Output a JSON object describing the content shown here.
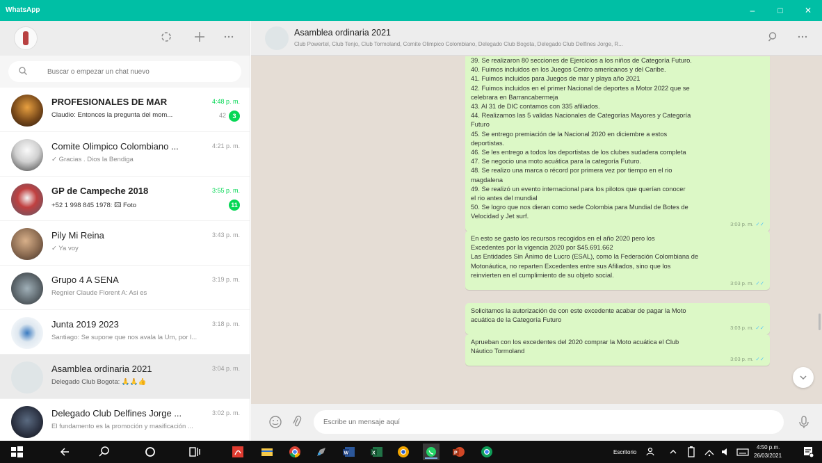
{
  "window": {
    "title": "WhatsApp",
    "buttons": {
      "minimize": "–",
      "maximize": "□",
      "close": "✕"
    }
  },
  "sidebar": {
    "icons": [
      "status-icon",
      "new-chat-icon",
      "menu-icon"
    ],
    "search": {
      "placeholder": "Buscar o empezar un chat nuevo",
      "value": ""
    },
    "chats": [
      {
        "name": "PROFESIONALES DE MAR",
        "time": "4:48 p. m.",
        "preview": "Claudio: Entonces la pregunta del mom...",
        "mention": "42",
        "unread": "3",
        "time_green": true
      },
      {
        "name": "Comite Olimpico Colombiano ...",
        "time": "4:21 p. m.",
        "preview": "✓ Gracias . Dios la Bendiga",
        "unread": "",
        "time_green": false
      },
      {
        "name": "GP de Campeche 2018",
        "time": "3:55 p. m.",
        "preview": "+52 1 998 845 1978: 🖾 Foto",
        "unread": "11",
        "time_green": true
      },
      {
        "name": "Pily Mi Reina",
        "time": "3:43 p. m.",
        "preview": "✓ Ya voy",
        "unread": "",
        "time_green": false
      },
      {
        "name": "Grupo 4 A SENA",
        "time": "3:19 p. m.",
        "preview": "Regnier Claude Florent A: Asi es",
        "unread": "",
        "time_green": false
      },
      {
        "name": "Junta 2019 2023",
        "time": "3:18 p. m.",
        "preview": "Santiago: Se supone que nos avala la Um, por l...",
        "unread": "",
        "time_green": false
      },
      {
        "name": "Asamblea ordinaria 2021",
        "time": "3:04 p. m.",
        "preview": "Delegado Club Bogota: 🙏🙏👍",
        "unread": "",
        "time_green": false,
        "active": true
      },
      {
        "name": "Delegado Club Delfines Jorge ...",
        "time": "3:02 p. m.",
        "preview": "El fundamento es la promoción y masificación ...",
        "unread": "",
        "time_green": false
      }
    ]
  },
  "conversation": {
    "title": "Asamblea ordinaria 2021",
    "members": "Club Powertel, Club Tenjo, Club Tormoland, Comite Olimpico Colombiano, Delegado Club Bogota, Delegado Club Delfines Jorge, R...",
    "messages": [
      {
        "lines": [
          "39.  Se realizaron 80 secciones de Ejercicios a los niños de Categoría Futuro.",
          "40.  Fuimos incluidos en los Juegos Centro americanos y del Caribe.",
          "41.  Fuimos incluidos para Juegos de mar y playa año 2021",
          "42.  Fuimos incluidos en el primer Nacional de deportes a Motor 2022 que se",
          "celebrara en Barrancabermeja",
          "43.  Al 31 de DIC contamos con 335 afiliados.",
          "44.  Realizamos las 5 validas Nacionales de Categorías Mayores y Categoría",
          "Futuro",
          "45.  Se entrego premiación de la Nacional 2020 en diciembre a estos",
          "deportistas.",
          "46.  Se les entrego a todos los deportistas de los clubes sudadera completa",
          "47.  Se negocio una moto acuática para la categoría Futuro.",
          "48.  Se realizo una marca o récord por primera vez por tiempo en el rio",
          "magdalena",
          "49.  Se realizó un evento internacional para los pilotos que querían conocer",
          "el rio antes del mundial",
          "50.  Se logro que nos dieran como sede Colombia para Mundial de Botes de",
          "Velocidad y Jet surf."
        ],
        "time": "3:03 p. m."
      },
      {
        "lines": [
          "En esto se gasto los recursos recogidos en el año 2020 pero los",
          "Excedentes por la vigencia 2020 por $45.691.662",
          "Las Entidades Sin Ánimo de Lucro (ESAL), como la Federación Colombiana de",
          "Motonáutica, no reparten Excedentes entre sus Afiliados, sino que los",
          "reinvierten en el cumplimiento de su objeto social."
        ],
        "time": "3:03 p. m."
      },
      {
        "lines": [
          "Solicitamos la autorización de con este excedente acabar de pagar la Moto",
          "acuática de la Categoría Futuro"
        ],
        "time": "3:03 p. m."
      },
      {
        "lines": [
          "Aprueban con los excedentes del 2020 comprar la Moto acuática el Club",
          "Náutico Tormoland"
        ],
        "time": "3:03 p. m."
      }
    ],
    "composer": {
      "placeholder": "Escribe un mensaje aquí",
      "value": ""
    }
  },
  "taskbar": {
    "language": "Escritorio",
    "clock_time": "4:50 p.m.",
    "clock_date": "26/03/2021"
  },
  "colors": {
    "accent": "#00bfa5",
    "bubble_out": "#dcf8c6",
    "chat_bg": "#e5ddd5",
    "unread_badge": "#06d755"
  }
}
